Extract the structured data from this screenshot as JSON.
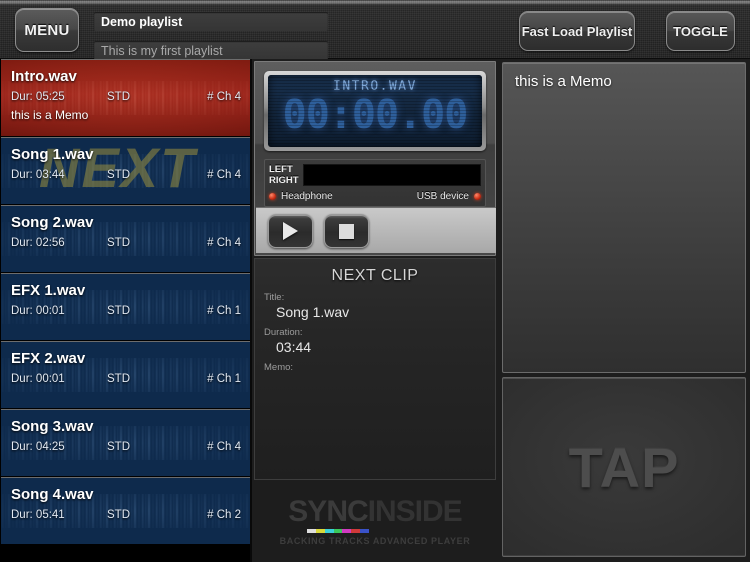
{
  "header": {
    "menu_label": "MENU",
    "playlist_title": "Demo playlist",
    "playlist_subtitle": "This is my first playlist",
    "fast_load_label": "Fast Load Playlist",
    "toggle_label": "TOGGLE"
  },
  "playlist": {
    "next_watermark": "NEXT",
    "clips": [
      {
        "name": "Intro.wav",
        "duration": "Dur: 05:25",
        "format": "STD",
        "channels": "# Ch 4",
        "memo": "this is a Memo",
        "state": "playing"
      },
      {
        "name": "Song 1.wav",
        "duration": "Dur: 03:44",
        "format": "STD",
        "channels": "# Ch 4",
        "memo": "",
        "state": "next"
      },
      {
        "name": "Song 2.wav",
        "duration": "Dur: 02:56",
        "format": "STD",
        "channels": "# Ch 4",
        "memo": "",
        "state": "idle"
      },
      {
        "name": "EFX 1.wav",
        "duration": "Dur: 00:01",
        "format": "STD",
        "channels": "# Ch 1",
        "memo": "",
        "state": "idle"
      },
      {
        "name": "EFX 2.wav",
        "duration": "Dur: 00:01",
        "format": "STD",
        "channels": "# Ch 1",
        "memo": "",
        "state": "idle"
      },
      {
        "name": "Song 3.wav",
        "duration": "Dur: 04:25",
        "format": "STD",
        "channels": "# Ch 4",
        "memo": "",
        "state": "idle"
      },
      {
        "name": "Song 4.wav",
        "duration": "Dur: 05:41",
        "format": "STD",
        "channels": "# Ch 2",
        "memo": "",
        "state": "idle"
      }
    ]
  },
  "player": {
    "lcd_title": "INTRO.WAV",
    "lcd_time": "00:00.00",
    "meter_left_label": "LEFT",
    "meter_right_label": "RIGHT",
    "headphone_label": "Headphone",
    "usb_label": "USB device",
    "play_icon": "play-icon",
    "stop_icon": "stop-icon"
  },
  "next_clip": {
    "heading": "NEXT CLIP",
    "title_label": "Title:",
    "title_value": "Song 1.wav",
    "duration_label": "Duration:",
    "duration_value": "03:44",
    "memo_label": "Memo:",
    "memo_value": ""
  },
  "brand": {
    "name_part1": "SYNC",
    "name_part2": "INSIDE",
    "tagline": "BACKING TRACKS ADVANCED PLAYER",
    "bar_colors": [
      "#dddddd",
      "#d8d83a",
      "#3ad0d8",
      "#3ac85a",
      "#d03ac0",
      "#d03a3a",
      "#3a52c8"
    ]
  },
  "memo_panel": {
    "text": "this is a Memo"
  },
  "tap_panel": {
    "label": "TAP"
  },
  "colors": {
    "playing_red": "#96221a",
    "clip_blue": "#0e2a4c",
    "lcd_blue": "#2e5f9b",
    "led_red": "#c72a12"
  }
}
